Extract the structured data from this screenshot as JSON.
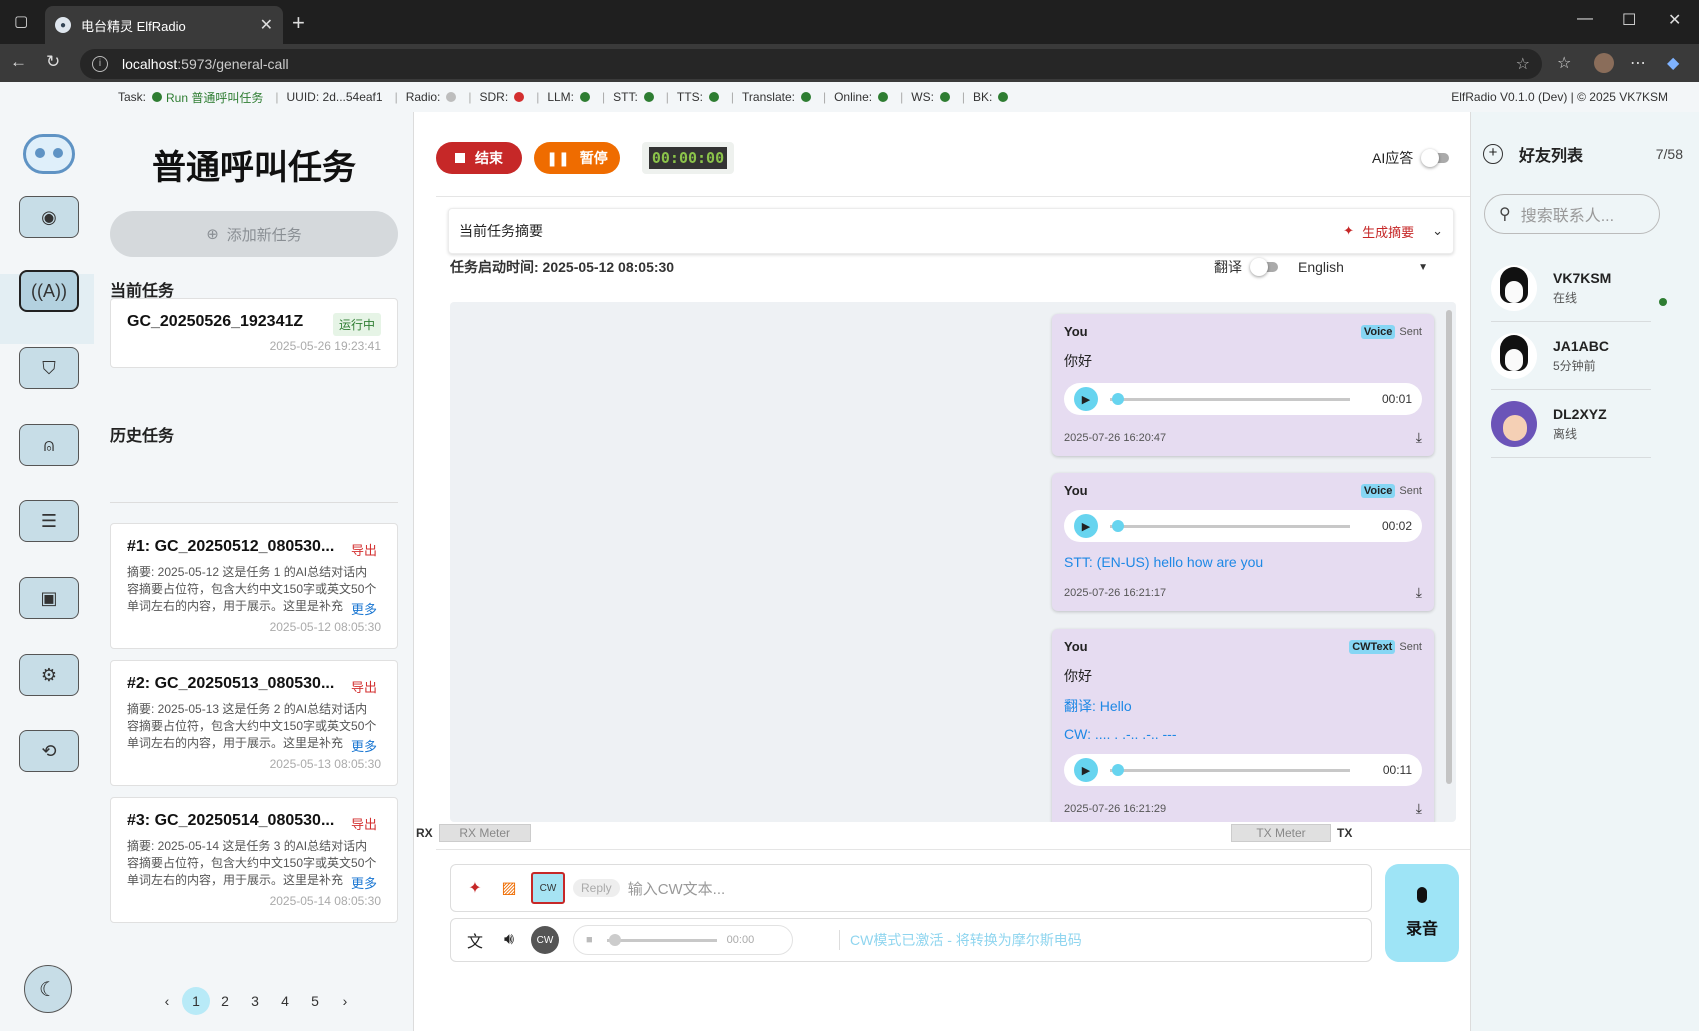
{
  "browser": {
    "tab_title": "电台精灵 ElfRadio",
    "url_host": "localhost",
    "url_path": ":5973/general-call"
  },
  "status_bar": {
    "task_label": "Task:",
    "task_value": "Run 普通呼叫任务",
    "uuid_label": "UUID:",
    "uuid_value": "2d...54eaf1",
    "indicators": [
      {
        "label": "Radio:",
        "color": "#bdbdbd"
      },
      {
        "label": "SDR:",
        "color": "#d32f2f"
      },
      {
        "label": "LLM:",
        "color": "#2e7d32"
      },
      {
        "label": "STT:",
        "color": "#2e7d32"
      },
      {
        "label": "TTS:",
        "color": "#2e7d32"
      },
      {
        "label": "Translate:",
        "color": "#2e7d32"
      },
      {
        "label": "Online:",
        "color": "#2e7d32"
      },
      {
        "label": "WS:",
        "color": "#2e7d32"
      },
      {
        "label": "BK:",
        "color": "#2e7d32"
      }
    ],
    "version": "ElfRadio V0.1.0 (Dev) | © 2025 VK7KSM"
  },
  "tasks_panel": {
    "title": "普通呼叫任务",
    "add_label": "添加新任务",
    "current_header": "当前任务",
    "current": {
      "name": "GC_20250526_192341Z",
      "badge": "运行中",
      "time": "2025-05-26 19:23:41"
    },
    "history_header": "历史任务",
    "history": [
      {
        "title": "#1: GC_20250512_080530...",
        "export": "导出",
        "summary": "摘要: 2025-05-12 这是任务 1 的AI总结对话内容摘要占位符，包含大约中文150字或英文50个单词左右的内容，用于展示。这里是补充",
        "more": "更多",
        "time": "2025-05-12 08:05:30"
      },
      {
        "title": "#2: GC_20250513_080530...",
        "export": "导出",
        "summary": "摘要: 2025-05-13 这是任务 2 的AI总结对话内容摘要占位符，包含大约中文150字或英文50个单词左右的内容，用于展示。这里是补充",
        "more": "更多",
        "time": "2025-05-13 08:05:30"
      },
      {
        "title": "#3: GC_20250514_080530...",
        "export": "导出",
        "summary": "摘要: 2025-05-14 这是任务 3 的AI总结对话内容摘要占位符，包含大约中文150字或英文50个单词左右的内容，用于展示。这里是补充",
        "more": "更多",
        "time": "2025-05-14 08:05:30"
      }
    ],
    "pages": [
      "1",
      "2",
      "3",
      "4",
      "5"
    ]
  },
  "main": {
    "end_label": "结束",
    "pause_label": "暂停",
    "timer": "00:00:00",
    "ai_reply_label": "AI应答",
    "summary_title": "当前任务摘要",
    "generate_label": "生成摘要",
    "start_time": "任务启动时间: 2025-05-12 08:05:30",
    "translate_label": "翻译",
    "language": "English",
    "messages": [
      {
        "sender": "You",
        "tag": "Voice",
        "status": "Sent",
        "text": "你好",
        "duration": "00:01",
        "time": "2025-07-26 16:20:47"
      },
      {
        "sender": "You",
        "tag": "Voice",
        "status": "Sent",
        "text": "STT: (EN-US) hello how are you",
        "duration": "00:02",
        "time": "2025-07-26 16:21:17"
      },
      {
        "sender": "You",
        "tag": "CWText",
        "status": "Sent",
        "text": "你好",
        "translation": "翻译: Hello",
        "cw": "CW: .... . .-.. .-.. ---",
        "duration": "00:11",
        "time": "2025-07-26 16:21:29"
      }
    ],
    "rx_label": "RX",
    "rx_meter": "RX Meter",
    "tx_meter": "TX Meter",
    "tx_label": "TX",
    "reply_chip": "Reply",
    "input_placeholder": "输入CW文本...",
    "cw_label": "CW",
    "mini_time": "00:00",
    "cw_mode_text": "CW模式已激活 - 将转换为摩尔斯电码",
    "record_label": "录音"
  },
  "friends": {
    "title": "好友列表",
    "count": "7/58",
    "search_placeholder": "搜索联系人...",
    "list": [
      {
        "name": "VK7KSM",
        "status": "在线"
      },
      {
        "name": "JA1ABC",
        "status": "5分钟前"
      },
      {
        "name": "DL2XYZ",
        "status": "离线"
      }
    ]
  }
}
